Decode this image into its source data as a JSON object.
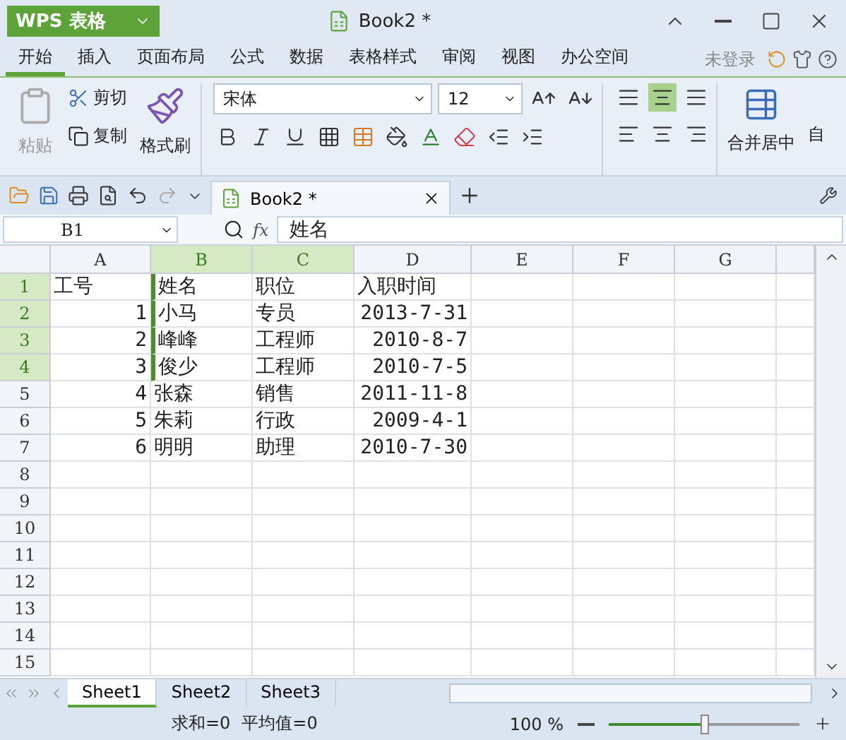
{
  "app": {
    "name": "WPS 表格",
    "title": "Book2 *"
  },
  "menu": [
    {
      "label": "开始",
      "selected": true
    },
    {
      "label": "插入",
      "selected": false
    },
    {
      "label": "页面布局",
      "selected": false
    },
    {
      "label": "公式",
      "selected": false
    },
    {
      "label": "数据",
      "selected": false
    },
    {
      "label": "表格样式",
      "selected": false
    },
    {
      "label": "审阅",
      "selected": false
    },
    {
      "label": "视图",
      "selected": false
    },
    {
      "label": "办公空间",
      "selected": false
    }
  ],
  "account": "未登录",
  "ribbon": {
    "paste": {
      "label": "粘贴",
      "disabled": true
    },
    "cut": "剪切",
    "copy": "复制",
    "format_painter": "格式刷",
    "font": "宋体",
    "font_size": "12",
    "merge": "合并居中",
    "wrap": "自"
  },
  "doc_tab": {
    "title": "Book2 *",
    "selected": true
  },
  "formula_bar": {
    "name_box": "B1",
    "fx": "fx",
    "value": "姓名"
  },
  "columns": [
    {
      "label": "A",
      "selected": false
    },
    {
      "label": "B",
      "selected": true
    },
    {
      "label": "C",
      "selected": true
    },
    {
      "label": "D",
      "selected": false
    },
    {
      "label": "E",
      "selected": false
    },
    {
      "label": "F",
      "selected": false
    },
    {
      "label": "G",
      "selected": false
    }
  ],
  "rows": [
    {
      "header": "1",
      "selected": true,
      "cells": [
        {
          "text": "工号",
          "kind": "text"
        },
        {
          "text": "姓名",
          "kind": "text"
        },
        {
          "text": "职位",
          "kind": "text"
        },
        {
          "text": "入职时间",
          "kind": "text"
        }
      ]
    },
    {
      "header": "2",
      "selected": true,
      "cells": [
        {
          "text": "1",
          "kind": "number"
        },
        {
          "text": "小马",
          "kind": "text"
        },
        {
          "text": "专员",
          "kind": "text"
        },
        {
          "text": "2013-7-31",
          "kind": "number"
        }
      ]
    },
    {
      "header": "3",
      "selected": true,
      "cells": [
        {
          "text": "2",
          "kind": "number"
        },
        {
          "text": "峰峰",
          "kind": "text"
        },
        {
          "text": "工程师",
          "kind": "text"
        },
        {
          "text": "2010-8-7",
          "kind": "number"
        }
      ]
    },
    {
      "header": "4",
      "selected": true,
      "cells": [
        {
          "text": "3",
          "kind": "number"
        },
        {
          "text": "俊少",
          "kind": "text"
        },
        {
          "text": "工程师",
          "kind": "text"
        },
        {
          "text": "2010-7-5",
          "kind": "number"
        }
      ]
    },
    {
      "header": "5",
      "selected": false,
      "cells": [
        {
          "text": "4",
          "kind": "number"
        },
        {
          "text": "张森",
          "kind": "text"
        },
        {
          "text": "销售",
          "kind": "text"
        },
        {
          "text": "2011-11-8",
          "kind": "number"
        }
      ]
    },
    {
      "header": "6",
      "selected": false,
      "cells": [
        {
          "text": "5",
          "kind": "number"
        },
        {
          "text": "朱莉",
          "kind": "text"
        },
        {
          "text": "行政",
          "kind": "text"
        },
        {
          "text": "2009-4-1",
          "kind": "number"
        }
      ]
    },
    {
      "header": "7",
      "selected": false,
      "cells": [
        {
          "text": "6",
          "kind": "number"
        },
        {
          "text": "明明",
          "kind": "text"
        },
        {
          "text": "助理",
          "kind": "text"
        },
        {
          "text": "2010-7-30",
          "kind": "number"
        }
      ]
    },
    {
      "header": "8",
      "selected": false
    },
    {
      "header": "9",
      "selected": false
    },
    {
      "header": "10",
      "selected": false
    },
    {
      "header": "11",
      "selected": false
    },
    {
      "header": "12",
      "selected": false
    },
    {
      "header": "13",
      "selected": false
    },
    {
      "header": "14",
      "selected": false
    },
    {
      "header": "15",
      "selected": false
    }
  ],
  "sheets": [
    {
      "label": "Sheet1",
      "selected": true
    },
    {
      "label": "Sheet2",
      "selected": false
    },
    {
      "label": "Sheet3",
      "selected": false
    }
  ],
  "status": {
    "sum": "求和=0",
    "average": "平均值=0",
    "zoom": "100 %",
    "zoom_slider": {
      "level": 0.5
    }
  }
}
